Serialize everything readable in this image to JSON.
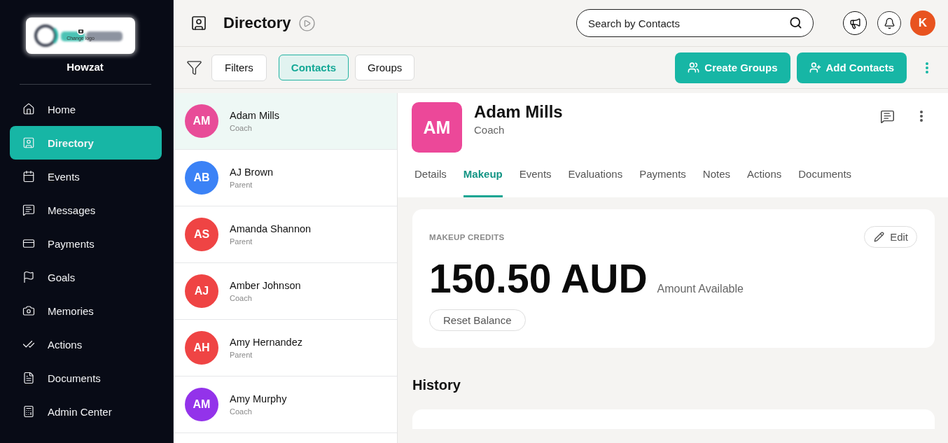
{
  "sidebar": {
    "logo": {
      "caption": "Change logo"
    },
    "org_name": "Howzat",
    "items": [
      {
        "label": "Home",
        "selected": false
      },
      {
        "label": "Directory",
        "selected": true
      },
      {
        "label": "Events",
        "selected": false
      },
      {
        "label": "Messages",
        "selected": false
      },
      {
        "label": "Payments",
        "selected": false
      },
      {
        "label": "Goals",
        "selected": false
      },
      {
        "label": "Memories",
        "selected": false
      },
      {
        "label": "Actions",
        "selected": false
      },
      {
        "label": "Documents",
        "selected": false
      },
      {
        "label": "Admin Center",
        "selected": false
      }
    ]
  },
  "header": {
    "title": "Directory",
    "search": {
      "placeholder": "Search by Contacts"
    },
    "user_avatar": "K"
  },
  "toolbar": {
    "filter_button": "Filters",
    "views": [
      {
        "label": "Contacts",
        "selected": true
      },
      {
        "label": "Groups",
        "selected": false
      }
    ],
    "actions": [
      "Create Groups",
      "Add Contacts"
    ]
  },
  "contacts": [
    {
      "initials": "AM",
      "name": "Adam Mills",
      "role": "Coach",
      "color": "#e84c98",
      "selected": true
    },
    {
      "initials": "AB",
      "name": "AJ Brown",
      "role": "Parent",
      "color": "#3b82f6",
      "selected": false
    },
    {
      "initials": "AS",
      "name": "Amanda Shannon",
      "role": "Parent",
      "color": "#ef4444",
      "selected": false
    },
    {
      "initials": "AJ",
      "name": "Amber Johnson",
      "role": "Coach",
      "color": "#ef4444",
      "selected": false
    },
    {
      "initials": "AH",
      "name": "Amy Hernandez",
      "role": "Parent",
      "color": "#ef4444",
      "selected": false
    },
    {
      "initials": "AM",
      "name": "Amy Murphy",
      "role": "Coach",
      "color": "#9333ea",
      "selected": false
    }
  ],
  "profile": {
    "initials": "AM",
    "name": "Adam Mills",
    "role": "Coach",
    "tabs": [
      {
        "label": "Details",
        "selected": false
      },
      {
        "label": "Makeup",
        "selected": true
      },
      {
        "label": "Events",
        "selected": false
      },
      {
        "label": "Evaluations",
        "selected": false
      },
      {
        "label": "Payments",
        "selected": false
      },
      {
        "label": "Notes",
        "selected": false
      },
      {
        "label": "Actions",
        "selected": false
      },
      {
        "label": "Documents",
        "selected": false
      }
    ]
  },
  "makeup_credits": {
    "label": "MAKEUP CREDITS",
    "edit_button": "Edit",
    "amount": "150.50 AUD",
    "amount_caption": "Amount Available",
    "reset_button": "Reset Balance"
  },
  "history": {
    "title": "History"
  }
}
